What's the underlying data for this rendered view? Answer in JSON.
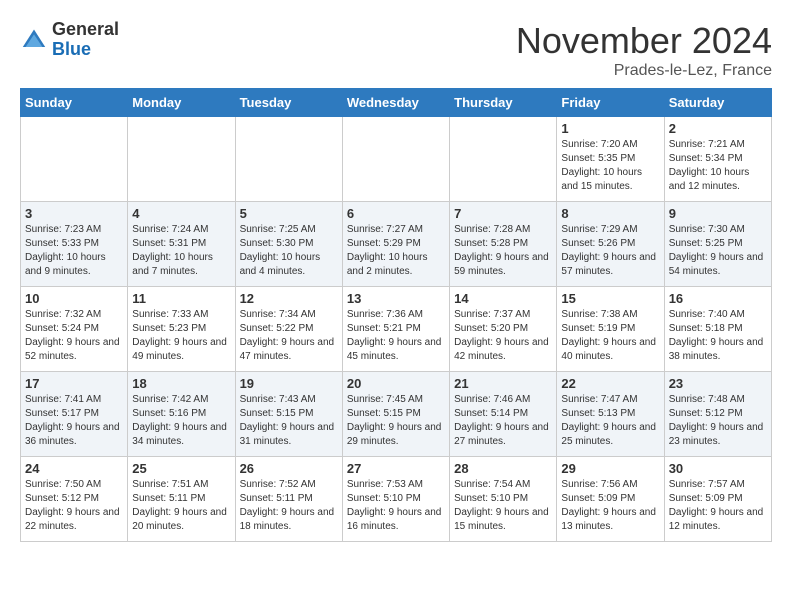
{
  "logo": {
    "general": "General",
    "blue": "Blue"
  },
  "header": {
    "month": "November 2024",
    "location": "Prades-le-Lez, France"
  },
  "weekdays": [
    "Sunday",
    "Monday",
    "Tuesday",
    "Wednesday",
    "Thursday",
    "Friday",
    "Saturday"
  ],
  "weeks": [
    [
      {
        "day": "",
        "info": ""
      },
      {
        "day": "",
        "info": ""
      },
      {
        "day": "",
        "info": ""
      },
      {
        "day": "",
        "info": ""
      },
      {
        "day": "",
        "info": ""
      },
      {
        "day": "1",
        "info": "Sunrise: 7:20 AM\nSunset: 5:35 PM\nDaylight: 10 hours and 15 minutes."
      },
      {
        "day": "2",
        "info": "Sunrise: 7:21 AM\nSunset: 5:34 PM\nDaylight: 10 hours and 12 minutes."
      }
    ],
    [
      {
        "day": "3",
        "info": "Sunrise: 7:23 AM\nSunset: 5:33 PM\nDaylight: 10 hours and 9 minutes."
      },
      {
        "day": "4",
        "info": "Sunrise: 7:24 AM\nSunset: 5:31 PM\nDaylight: 10 hours and 7 minutes."
      },
      {
        "day": "5",
        "info": "Sunrise: 7:25 AM\nSunset: 5:30 PM\nDaylight: 10 hours and 4 minutes."
      },
      {
        "day": "6",
        "info": "Sunrise: 7:27 AM\nSunset: 5:29 PM\nDaylight: 10 hours and 2 minutes."
      },
      {
        "day": "7",
        "info": "Sunrise: 7:28 AM\nSunset: 5:28 PM\nDaylight: 9 hours and 59 minutes."
      },
      {
        "day": "8",
        "info": "Sunrise: 7:29 AM\nSunset: 5:26 PM\nDaylight: 9 hours and 57 minutes."
      },
      {
        "day": "9",
        "info": "Sunrise: 7:30 AM\nSunset: 5:25 PM\nDaylight: 9 hours and 54 minutes."
      }
    ],
    [
      {
        "day": "10",
        "info": "Sunrise: 7:32 AM\nSunset: 5:24 PM\nDaylight: 9 hours and 52 minutes."
      },
      {
        "day": "11",
        "info": "Sunrise: 7:33 AM\nSunset: 5:23 PM\nDaylight: 9 hours and 49 minutes."
      },
      {
        "day": "12",
        "info": "Sunrise: 7:34 AM\nSunset: 5:22 PM\nDaylight: 9 hours and 47 minutes."
      },
      {
        "day": "13",
        "info": "Sunrise: 7:36 AM\nSunset: 5:21 PM\nDaylight: 9 hours and 45 minutes."
      },
      {
        "day": "14",
        "info": "Sunrise: 7:37 AM\nSunset: 5:20 PM\nDaylight: 9 hours and 42 minutes."
      },
      {
        "day": "15",
        "info": "Sunrise: 7:38 AM\nSunset: 5:19 PM\nDaylight: 9 hours and 40 minutes."
      },
      {
        "day": "16",
        "info": "Sunrise: 7:40 AM\nSunset: 5:18 PM\nDaylight: 9 hours and 38 minutes."
      }
    ],
    [
      {
        "day": "17",
        "info": "Sunrise: 7:41 AM\nSunset: 5:17 PM\nDaylight: 9 hours and 36 minutes."
      },
      {
        "day": "18",
        "info": "Sunrise: 7:42 AM\nSunset: 5:16 PM\nDaylight: 9 hours and 34 minutes."
      },
      {
        "day": "19",
        "info": "Sunrise: 7:43 AM\nSunset: 5:15 PM\nDaylight: 9 hours and 31 minutes."
      },
      {
        "day": "20",
        "info": "Sunrise: 7:45 AM\nSunset: 5:15 PM\nDaylight: 9 hours and 29 minutes."
      },
      {
        "day": "21",
        "info": "Sunrise: 7:46 AM\nSunset: 5:14 PM\nDaylight: 9 hours and 27 minutes."
      },
      {
        "day": "22",
        "info": "Sunrise: 7:47 AM\nSunset: 5:13 PM\nDaylight: 9 hours and 25 minutes."
      },
      {
        "day": "23",
        "info": "Sunrise: 7:48 AM\nSunset: 5:12 PM\nDaylight: 9 hours and 23 minutes."
      }
    ],
    [
      {
        "day": "24",
        "info": "Sunrise: 7:50 AM\nSunset: 5:12 PM\nDaylight: 9 hours and 22 minutes."
      },
      {
        "day": "25",
        "info": "Sunrise: 7:51 AM\nSunset: 5:11 PM\nDaylight: 9 hours and 20 minutes."
      },
      {
        "day": "26",
        "info": "Sunrise: 7:52 AM\nSunset: 5:11 PM\nDaylight: 9 hours and 18 minutes."
      },
      {
        "day": "27",
        "info": "Sunrise: 7:53 AM\nSunset: 5:10 PM\nDaylight: 9 hours and 16 minutes."
      },
      {
        "day": "28",
        "info": "Sunrise: 7:54 AM\nSunset: 5:10 PM\nDaylight: 9 hours and 15 minutes."
      },
      {
        "day": "29",
        "info": "Sunrise: 7:56 AM\nSunset: 5:09 PM\nDaylight: 9 hours and 13 minutes."
      },
      {
        "day": "30",
        "info": "Sunrise: 7:57 AM\nSunset: 5:09 PM\nDaylight: 9 hours and 12 minutes."
      }
    ]
  ]
}
